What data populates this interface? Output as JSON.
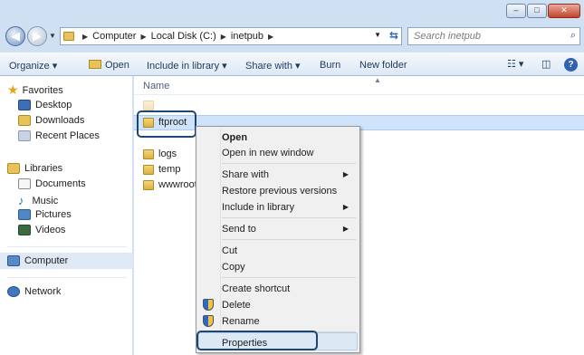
{
  "window": {
    "caption": {
      "minimize": "–",
      "maximize": "□",
      "close": "✕"
    }
  },
  "address_bar": {
    "nav_back_glyph": "◀",
    "nav_fwd_glyph": "▶",
    "crumbs": [
      "Computer",
      "Local Disk (C:)",
      "inetpub"
    ],
    "search_placeholder": "Search inetpub"
  },
  "toolbar": {
    "organize": "Organize ▾",
    "open": "Open",
    "include_in_library": "Include in library ▾",
    "share_with": "Share with ▾",
    "burn": "Burn",
    "new_folder": "New folder",
    "help": "?"
  },
  "nav_pane": {
    "favorites": "Favorites",
    "desktop": "Desktop",
    "downloads": "Downloads",
    "recent_places": "Recent Places",
    "libraries": "Libraries",
    "documents": "Documents",
    "music": "Music",
    "pictures": "Pictures",
    "videos": "Videos",
    "computer": "Computer",
    "network": "Network"
  },
  "content": {
    "column_name": "Name",
    "files": [
      "ftproot",
      "logs",
      "temp",
      "wwwroot"
    ]
  },
  "context_menu": {
    "open": "Open",
    "open_new_window": "Open in new window",
    "share_with": "Share with",
    "restore_previous": "Restore previous versions",
    "include_in_library": "Include in library",
    "send_to": "Send to",
    "cut": "Cut",
    "copy": "Copy",
    "create_shortcut": "Create shortcut",
    "delete": "Delete",
    "rename": "Rename",
    "properties": "Properties"
  },
  "colors": {
    "window_frame": "#cfe0f3",
    "selection": "#cfe3fa",
    "callout": "#1f4573"
  }
}
